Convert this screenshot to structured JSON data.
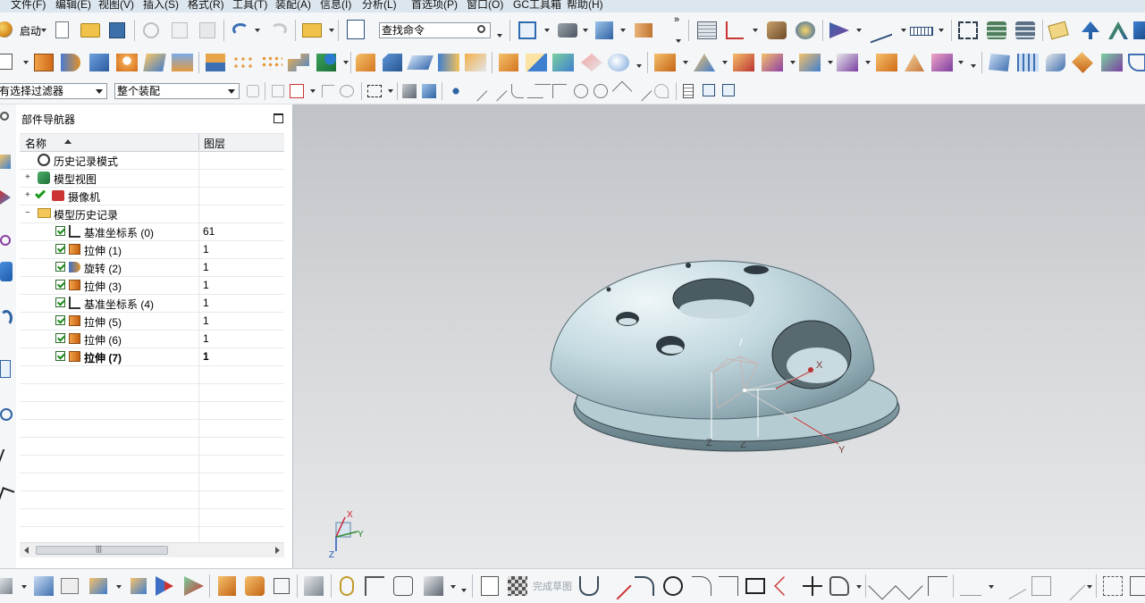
{
  "menu": {
    "items": [
      "文件(F)",
      "编辑(E)",
      "视图(V)",
      "插入(S)",
      "格式(R)",
      "工具(T)",
      "装配(A)",
      "信息(I)",
      "分析(L)",
      "首选项(P)",
      "窗口(O)",
      "GC工具箱",
      "帮助(H)"
    ]
  },
  "toolbar": {
    "start_label": "启动",
    "search": {
      "value": "查找命令"
    },
    "filter": {
      "value": "有选择过滤器"
    },
    "scope": {
      "value": "整个装配"
    },
    "sketch_done_label": "完成草图"
  },
  "navigator": {
    "title": "部件导航器",
    "columns": {
      "name": "名称",
      "layer": "图层"
    },
    "rows": [
      {
        "label": "历史记录模式",
        "layer": "",
        "icon": "clock-icon"
      },
      {
        "label": "模型视图",
        "layer": "",
        "icon": "model-views-icon"
      },
      {
        "label": "摄像机",
        "layer": "",
        "icon": "camera-icon"
      },
      {
        "label": "模型历史记录",
        "layer": "",
        "icon": "folder-icon"
      },
      {
        "label": "基准坐标系 (0)",
        "layer": "61",
        "icon": "datum-csys-icon"
      },
      {
        "label": "拉伸 (1)",
        "layer": "1",
        "icon": "extrude-icon"
      },
      {
        "label": "旋转 (2)",
        "layer": "1",
        "icon": "revolve-icon"
      },
      {
        "label": "拉伸 (3)",
        "layer": "1",
        "icon": "extrude-icon"
      },
      {
        "label": "基准坐标系 (4)",
        "layer": "1",
        "icon": "datum-csys-icon"
      },
      {
        "label": "拉伸 (5)",
        "layer": "1",
        "icon": "extrude-icon"
      },
      {
        "label": "拉伸 (6)",
        "layer": "1",
        "icon": "extrude-icon"
      },
      {
        "label": "拉伸 (7)",
        "layer": "1",
        "icon": "extrude-icon"
      }
    ]
  },
  "viewport": {
    "axis_labels": {
      "x": "X",
      "y": "Y",
      "z": "Z"
    },
    "colors": {
      "part": "#b9d1d9",
      "background_top": "#bfc3c7",
      "background_bottom": "#e7e8ea"
    }
  },
  "scroll": {
    "grip": "|||"
  }
}
